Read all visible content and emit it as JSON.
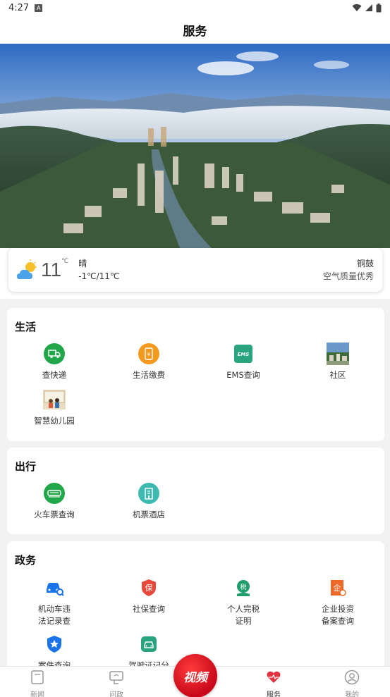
{
  "status": {
    "time": "4:27",
    "a_badge": "A"
  },
  "header": {
    "title": "服务"
  },
  "weather": {
    "temperature": "11",
    "unit": "℃",
    "condition": "晴",
    "range": "-1℃/11℃",
    "city": "铜鼓",
    "air_quality": "空气质量优秀"
  },
  "sections": {
    "life": {
      "title": "生活",
      "items": [
        {
          "label": "查快递",
          "icon": "truck-icon"
        },
        {
          "label": "生活缴费",
          "icon": "phone-bill-icon"
        },
        {
          "label": "EMS查询",
          "icon": "ems-icon"
        },
        {
          "label": "社区",
          "icon": "community-photo"
        },
        {
          "label": "智慧幼儿园",
          "icon": "kindergarten-photo"
        }
      ]
    },
    "travel": {
      "title": "出行",
      "items": [
        {
          "label": "火车票查询",
          "icon": "train-icon"
        },
        {
          "label": "机票酒店",
          "icon": "hotel-icon"
        }
      ]
    },
    "gov": {
      "title": "政务",
      "items": [
        {
          "label_line1": "机动车违",
          "label_line2": "法记录查",
          "icon": "car-search-icon"
        },
        {
          "label_line1": "社保查询",
          "label_line2": "",
          "icon": "insurance-icon"
        },
        {
          "label_line1": "个人完税",
          "label_line2": "证明",
          "icon": "tax-icon"
        },
        {
          "label_line1": "企业投资",
          "label_line2": "备案查询",
          "icon": "enterprise-icon"
        },
        {
          "label_line1": "案件查询",
          "label_line2": "",
          "icon": "police-badge-icon"
        },
        {
          "label_line1": "驾驶证记分",
          "label_line2": "",
          "icon": "driving-license-icon"
        }
      ]
    }
  },
  "tabs": {
    "news": "新闻",
    "politics": "问政",
    "video": "视频",
    "service": "服务",
    "mine": "我的"
  },
  "colors": {
    "green": "#21a64a",
    "orange": "#f39a1e",
    "teal": "#2aa37f",
    "cyan": "#3fbab0",
    "blue": "#1a73e8",
    "red": "#e8473b",
    "tax_green": "#1f9d6a",
    "active_red": "#e0333f"
  }
}
